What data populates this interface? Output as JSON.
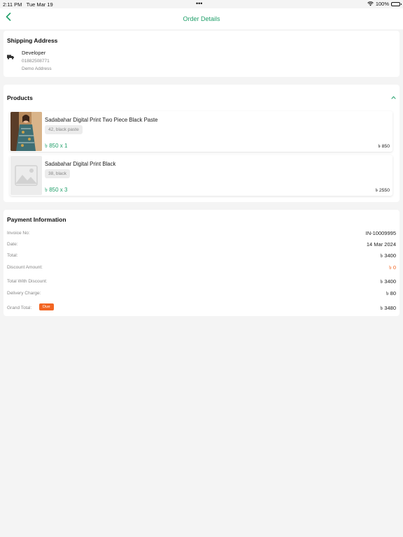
{
  "status_bar": {
    "time": "2:11 PM",
    "date": "Tue Mar 19",
    "dots": "•••",
    "battery": "100%"
  },
  "header": {
    "title": "Order Details"
  },
  "shipping": {
    "title": "Shipping Address",
    "name": "Developer",
    "phone": "01882508771",
    "address": "Demo Address"
  },
  "products": {
    "title": "Products",
    "items": [
      {
        "name": "Sadabahar Digital Print Two Piece Black Paste",
        "variant": "42, black paste",
        "price": "৳ 850 x 1",
        "total": "৳ 850"
      },
      {
        "name": "Sadabahar Digital Print Black",
        "variant": "38, black",
        "price": "৳ 850 x 3",
        "total": "৳ 2550"
      }
    ]
  },
  "payment": {
    "title": "Payment Information",
    "invoice_label": "Invoice No:",
    "invoice_value": "IN-10009995",
    "date_label": "Date:",
    "date_value": "14 Mar 2024",
    "total_label": "Total:",
    "total_value": "৳ 3400",
    "discount_label": "Discount Amount:",
    "discount_value": "৳ 0",
    "twd_label": "Total With Discount:",
    "twd_value": "৳ 3400",
    "delivery_label": "Delivery Charge:",
    "delivery_value": "৳ 80",
    "grand_label": "Grand Total:",
    "grand_badge": "Due",
    "grand_value": "৳ 3480"
  },
  "colors": {
    "accent": "#22a06b",
    "due_badge": "#f26522",
    "background": "#f4f4f4"
  }
}
